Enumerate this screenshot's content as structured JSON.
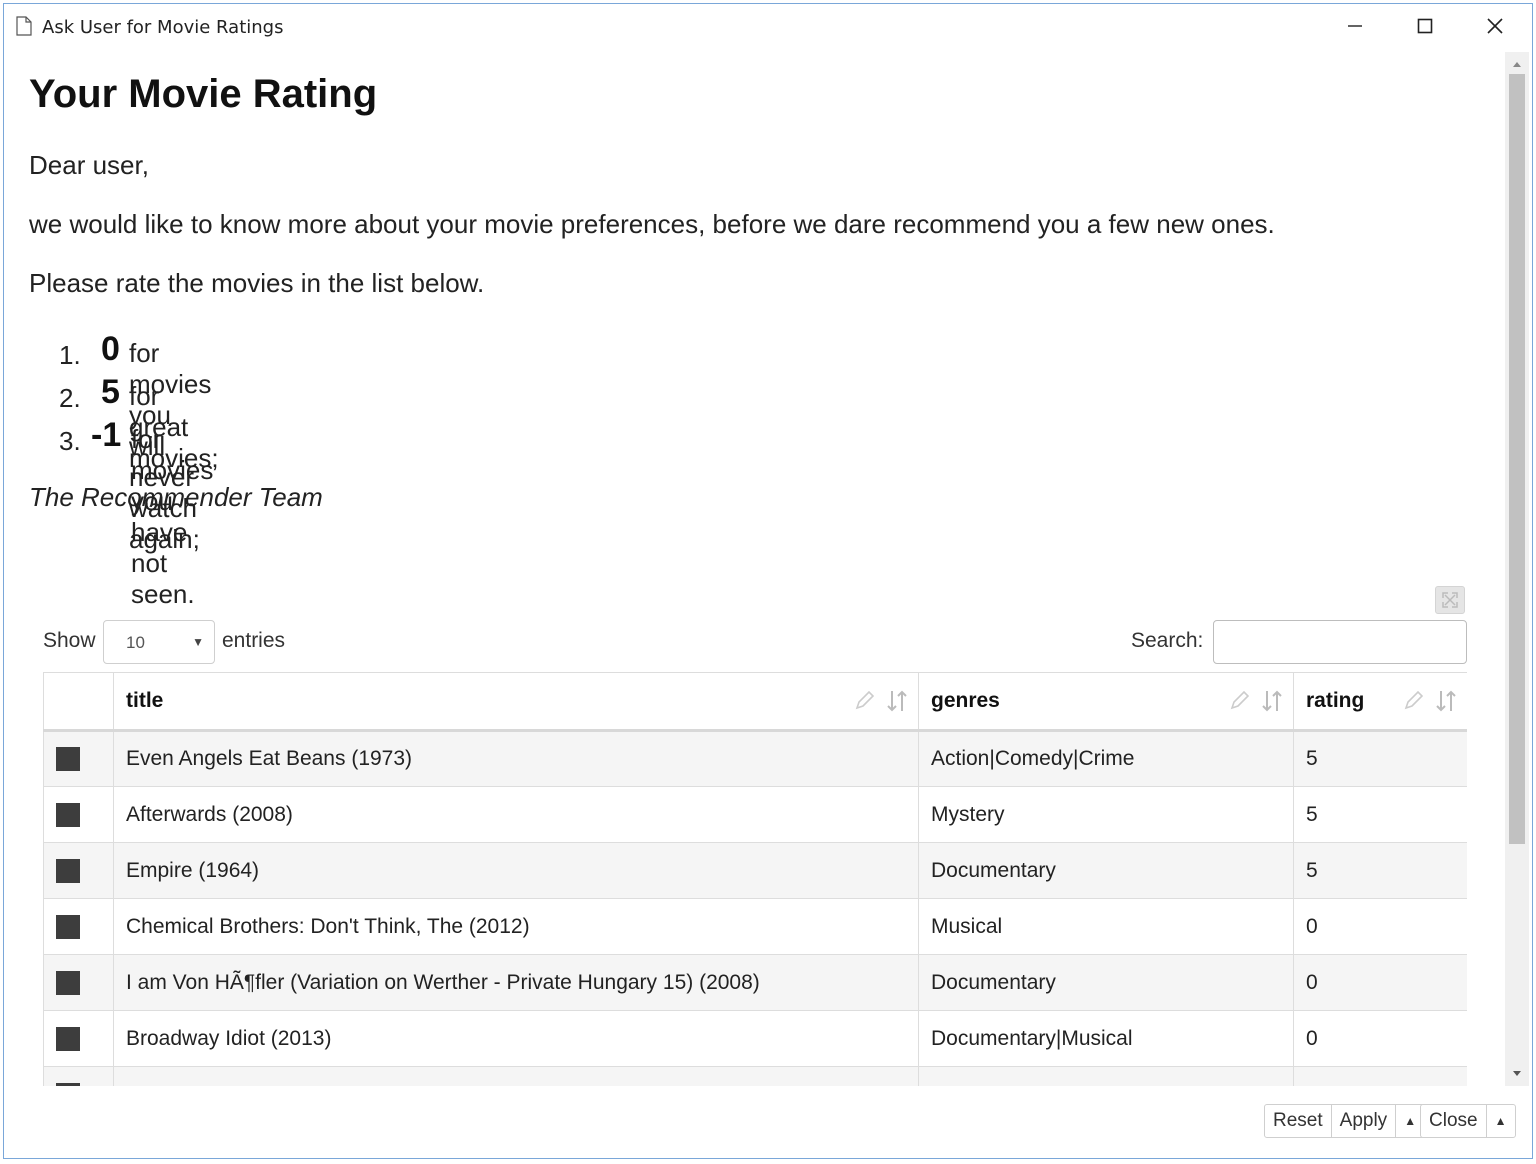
{
  "window": {
    "title": "Ask User for Movie Ratings"
  },
  "heading": "Your Movie Rating",
  "greeting": "Dear user,",
  "intro": "we would like to know more about your movie preferences, before we dare recommend you a few new ones.",
  "instruction": "Please rate the movies in the list below.",
  "rules": [
    {
      "num": "1.",
      "value": "0",
      "text": "for movies you will never watch again;"
    },
    {
      "num": "2.",
      "value": "5",
      "text": "for great movies;"
    },
    {
      "num": "3.",
      "value": "-1",
      "text": "for movies you have not seen."
    }
  ],
  "signature": "The Recommender Team",
  "controls": {
    "show_label": "Show",
    "page_size": "10",
    "entries_label": "entries",
    "search_label": "Search:",
    "search_value": ""
  },
  "table": {
    "columns": [
      "",
      "title",
      "genres",
      "rating"
    ],
    "rows": [
      {
        "title": "Even Angels Eat Beans (1973)",
        "genres": "Action|Comedy|Crime",
        "rating": "5"
      },
      {
        "title": "Afterwards (2008)",
        "genres": "Mystery",
        "rating": "5"
      },
      {
        "title": "Empire (1964)",
        "genres": "Documentary",
        "rating": "5"
      },
      {
        "title": "Chemical Brothers: Don't Think, The (2012)",
        "genres": "Musical",
        "rating": "0"
      },
      {
        "title": "I am Von HÃ¶fler (Variation on Werther - Private Hungary 15) (2008)",
        "genres": "Documentary",
        "rating": "0"
      },
      {
        "title": "Broadway Idiot (2013)",
        "genres": "Documentary|Musical",
        "rating": "0"
      },
      {
        "title": "",
        "genres": "",
        "rating": ""
      }
    ]
  },
  "footer": {
    "reset": "Reset",
    "apply": "Apply",
    "close": "Close"
  },
  "colors": {
    "row_stripe": "#f5f5f5",
    "marker": "#3d3d3d",
    "border": "#dddddd"
  }
}
